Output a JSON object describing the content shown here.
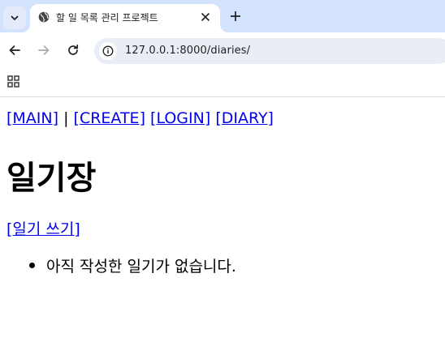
{
  "browser": {
    "tab": {
      "title": "할 일 목록 관리 프로젝트",
      "favicon": "globe-icon"
    },
    "address": {
      "url": "127.0.0.1:8000/diaries/"
    },
    "icons": {
      "tab_search": "chevron-down-icon",
      "tab_close": "close-icon",
      "new_tab": "plus-icon",
      "back": "arrow-left-icon",
      "forward": "arrow-right-icon",
      "reload": "reload-icon",
      "site_info": "info-icon",
      "apps": "apps-grid-icon"
    },
    "colors": {
      "tabstrip_bg": "#d3e3fd",
      "omnibox_bg": "#e9eef6",
      "link": "#0000ee"
    }
  },
  "page": {
    "nav": {
      "main": "[MAIN]",
      "separator": "|",
      "create": "[CREATE]",
      "login": "[LOGIN]",
      "diary": "[DIARY]"
    },
    "title": "일기장",
    "write_link": "[일기 쓰기]",
    "list_items": [
      "아직 작성한 일기가 없습니다."
    ]
  }
}
